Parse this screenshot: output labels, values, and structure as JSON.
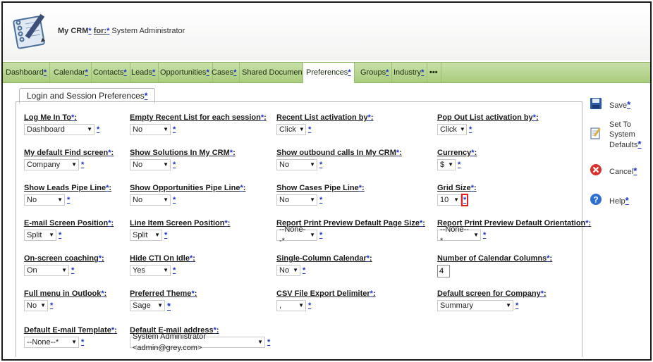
{
  "header": {
    "app_name": "My CRM",
    "for_label": "for:",
    "user": "System Administrator",
    "star": "*"
  },
  "tabs": [
    {
      "label": "Dashboard",
      "star": "*",
      "active": false
    },
    {
      "label": "Calendar",
      "star": "*",
      "active": false
    },
    {
      "label": "Contacts",
      "star": "*",
      "active": false
    },
    {
      "label": "Leads",
      "star": "*",
      "active": false
    },
    {
      "label": "Opportunities",
      "star": "*",
      "active": false
    },
    {
      "label": "Cases",
      "star": "*",
      "active": false
    },
    {
      "label": "Shared Documents",
      "star": "*",
      "active": false
    },
    {
      "label": "Preferences",
      "star": "*",
      "active": true
    },
    {
      "label": "Groups",
      "star": "*",
      "active": false
    },
    {
      "label": "Industry",
      "star": "*",
      "active": false
    },
    {
      "label": "•••",
      "star": "",
      "active": false
    }
  ],
  "panel": {
    "title": "Login and Session Preferences",
    "star": "*"
  },
  "fields": {
    "log_me_in_to": {
      "label": "Log Me In To",
      "value": "Dashboard"
    },
    "empty_recent": {
      "label": "Empty Recent List for each session",
      "value": "No"
    },
    "recent_activation": {
      "label": "Recent List activation by",
      "value": "Click"
    },
    "popout_activation": {
      "label": "Pop Out List activation by",
      "value": "Click"
    },
    "default_find": {
      "label": "My default Find screen",
      "value": "Company"
    },
    "show_solutions": {
      "label": "Show Solutions In My CRM",
      "value": "No"
    },
    "show_outbound": {
      "label": "Show outbound calls In My CRM",
      "value": "No"
    },
    "currency": {
      "label": "Currency",
      "value": "$"
    },
    "leads_pipe": {
      "label": "Show Leads Pipe Line",
      "value": "No"
    },
    "opps_pipe": {
      "label": "Show Opportunities Pipe Line",
      "value": "No"
    },
    "cases_pipe": {
      "label": "Show Cases Pipe Line",
      "value": "No"
    },
    "grid_size": {
      "label": "Grid Size",
      "value": "10"
    },
    "email_pos": {
      "label": "E-mail Screen Position",
      "value": "Split"
    },
    "lineitem_pos": {
      "label": "Line Item Screen Position",
      "value": "Split"
    },
    "print_size": {
      "label": "Report Print Preview Default Page Size",
      "value": "--None--*"
    },
    "print_orient": {
      "label": "Report Print Preview Default Orientation",
      "value": "--None--*"
    },
    "coaching": {
      "label": "On-screen coaching",
      "value": "On"
    },
    "hide_cti": {
      "label": "Hide CTI On Idle",
      "value": "Yes"
    },
    "single_col": {
      "label": "Single-Column Calendar",
      "value": "No"
    },
    "cal_columns": {
      "label": "Number of Calendar Columns",
      "value": "4"
    },
    "full_menu": {
      "label": "Full menu in Outlook",
      "value": "No"
    },
    "theme": {
      "label": "Preferred Theme",
      "value": "Sage"
    },
    "csv_delim": {
      "label": "CSV File Export Delimiter",
      "value": ","
    },
    "company_screen": {
      "label": "Default screen for Company",
      "value": "Summary"
    },
    "email_template": {
      "label": "Default E-mail Template",
      "value": "--None--*"
    },
    "email_address": {
      "label": "Default E-mail address",
      "value": "System Administrator <admin@grey.com>"
    }
  },
  "colon": ":",
  "star": "*",
  "sidebar": {
    "save": "Save",
    "set_defaults_1": "Set To",
    "set_defaults_2": "System",
    "set_defaults_3": "Defaults",
    "cancel": "Cancel",
    "help": "Help"
  },
  "icons": {
    "logo": "notebook-pen-logo",
    "save": "floppy-disk-icon",
    "defaults": "checklist-pen-icon",
    "cancel": "cancel-x-icon",
    "help": "help-question-icon"
  },
  "colors": {
    "tabbar": "#b7d592",
    "link_star": "#1a33c7",
    "highlight": "#e0201c"
  }
}
